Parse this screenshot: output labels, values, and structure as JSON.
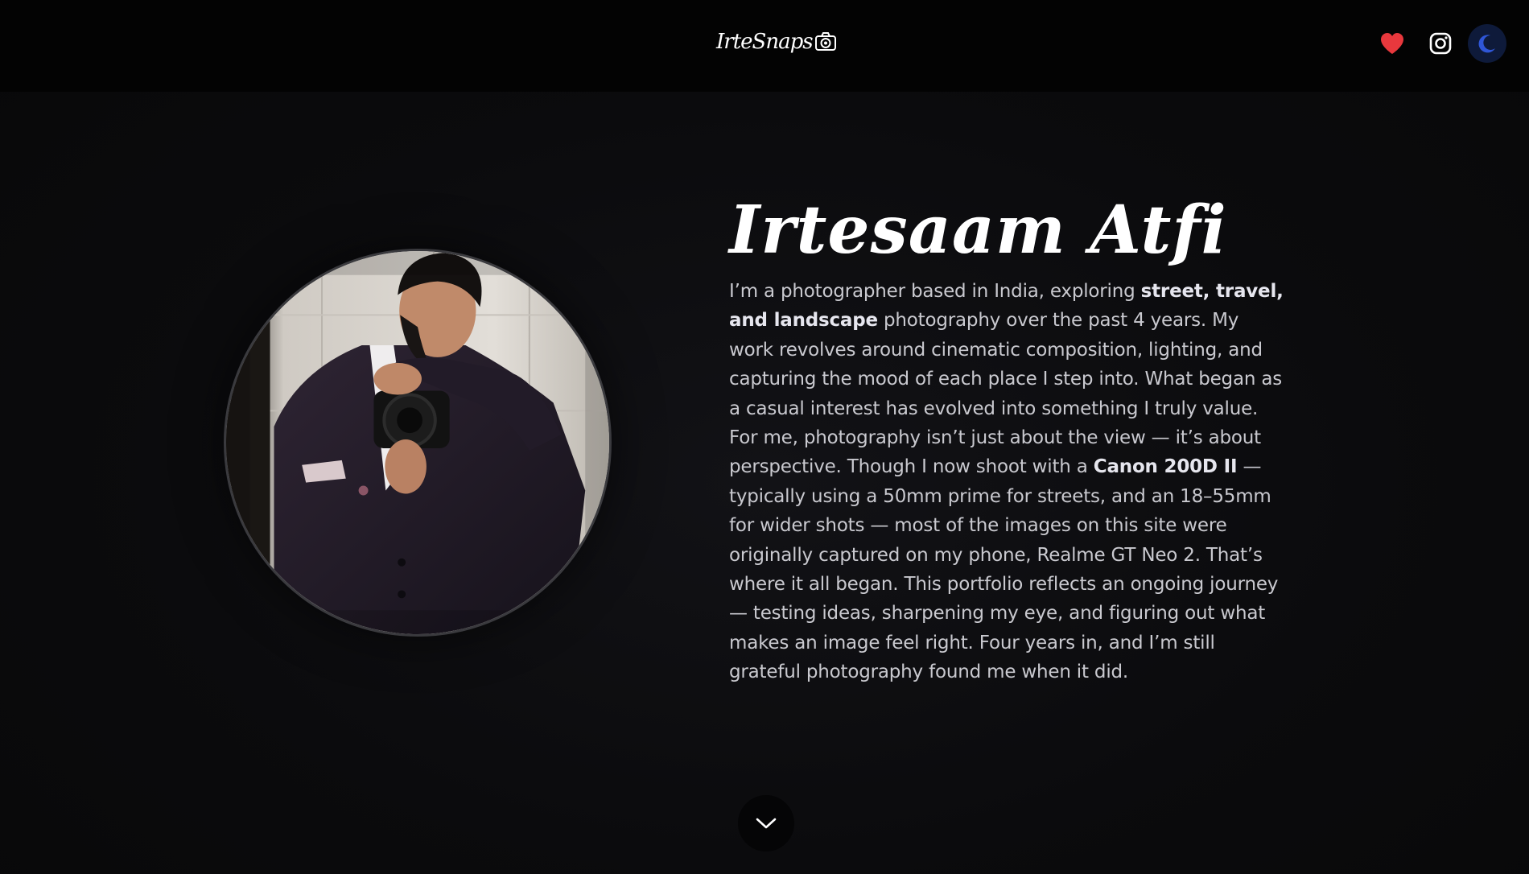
{
  "header": {
    "logo_text": "IrteSnaps",
    "icons": {
      "favorites": "heart-icon",
      "instagram": "instagram-icon",
      "theme_toggle": "moon-icon"
    },
    "heart_color": "#e8383d",
    "moon_color": "#2f56d6"
  },
  "profile": {
    "name": "Irtesaam Atfi",
    "photo": "portrait-photo",
    "bio": {
      "p1": "I’m a photographer based in India, exploring ",
      "b1": "street, travel, and landscape",
      "p2": " photography over the past 4 years. My work revolves around cinematic composition, lighting, and capturing the mood of each place I step into. What began as a casual interest has evolved into something I truly value. For me, photography isn’t just about the view — it’s about perspective. Though I now shoot with a ",
      "b2": "Canon 200D II",
      "p3": " — typically using a 50mm prime for streets, and an 18–55mm for wider shots — most of the images on this site were originally captured on my phone, Realme GT Neo 2. That’s where it all began. This portfolio reflects an ongoing journey — testing ideas, sharpening my eye, and figuring out what makes an image feel right. Four years in, and I’m still grateful photography found me when it did."
    }
  },
  "scroll": {
    "icon": "chevron-down-icon"
  }
}
